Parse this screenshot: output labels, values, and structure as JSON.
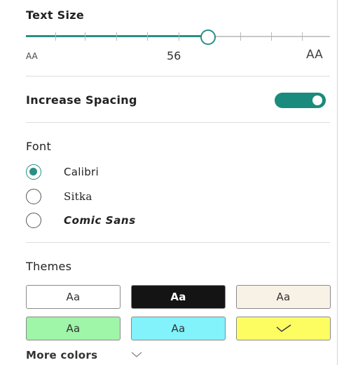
{
  "text_size": {
    "title": "Text Size",
    "small_label": "AA",
    "value": "56",
    "large_label": "AA",
    "level_fraction": 0.6
  },
  "spacing": {
    "label": "Increase Spacing",
    "enabled": true
  },
  "font": {
    "title": "Font",
    "options": [
      {
        "label": "Calibri",
        "selected": true
      },
      {
        "label": "Sitka",
        "selected": false
      },
      {
        "label": "Comic Sans",
        "selected": false
      }
    ]
  },
  "themes": {
    "title": "Themes",
    "swatches": [
      {
        "label": "Aa",
        "bg": "#ffffff",
        "fg": "#333333",
        "selected": false
      },
      {
        "label": "Aa",
        "bg": "#141414",
        "fg": "#ffffff",
        "selected": false
      },
      {
        "label": "Aa",
        "bg": "#f8f2e6",
        "fg": "#333333",
        "selected": false
      },
      {
        "label": "Aa",
        "bg": "#9ff5a8",
        "fg": "#333333",
        "selected": false
      },
      {
        "label": "Aa",
        "bg": "#82f2fb",
        "fg": "#333333",
        "selected": false
      },
      {
        "label": "",
        "bg": "#fdfd62",
        "fg": "#333333",
        "selected": true
      }
    ],
    "more_label": "More colors"
  },
  "colors": {
    "accent": "#2a8f86",
    "toggle_on": "#1a8b7c"
  }
}
